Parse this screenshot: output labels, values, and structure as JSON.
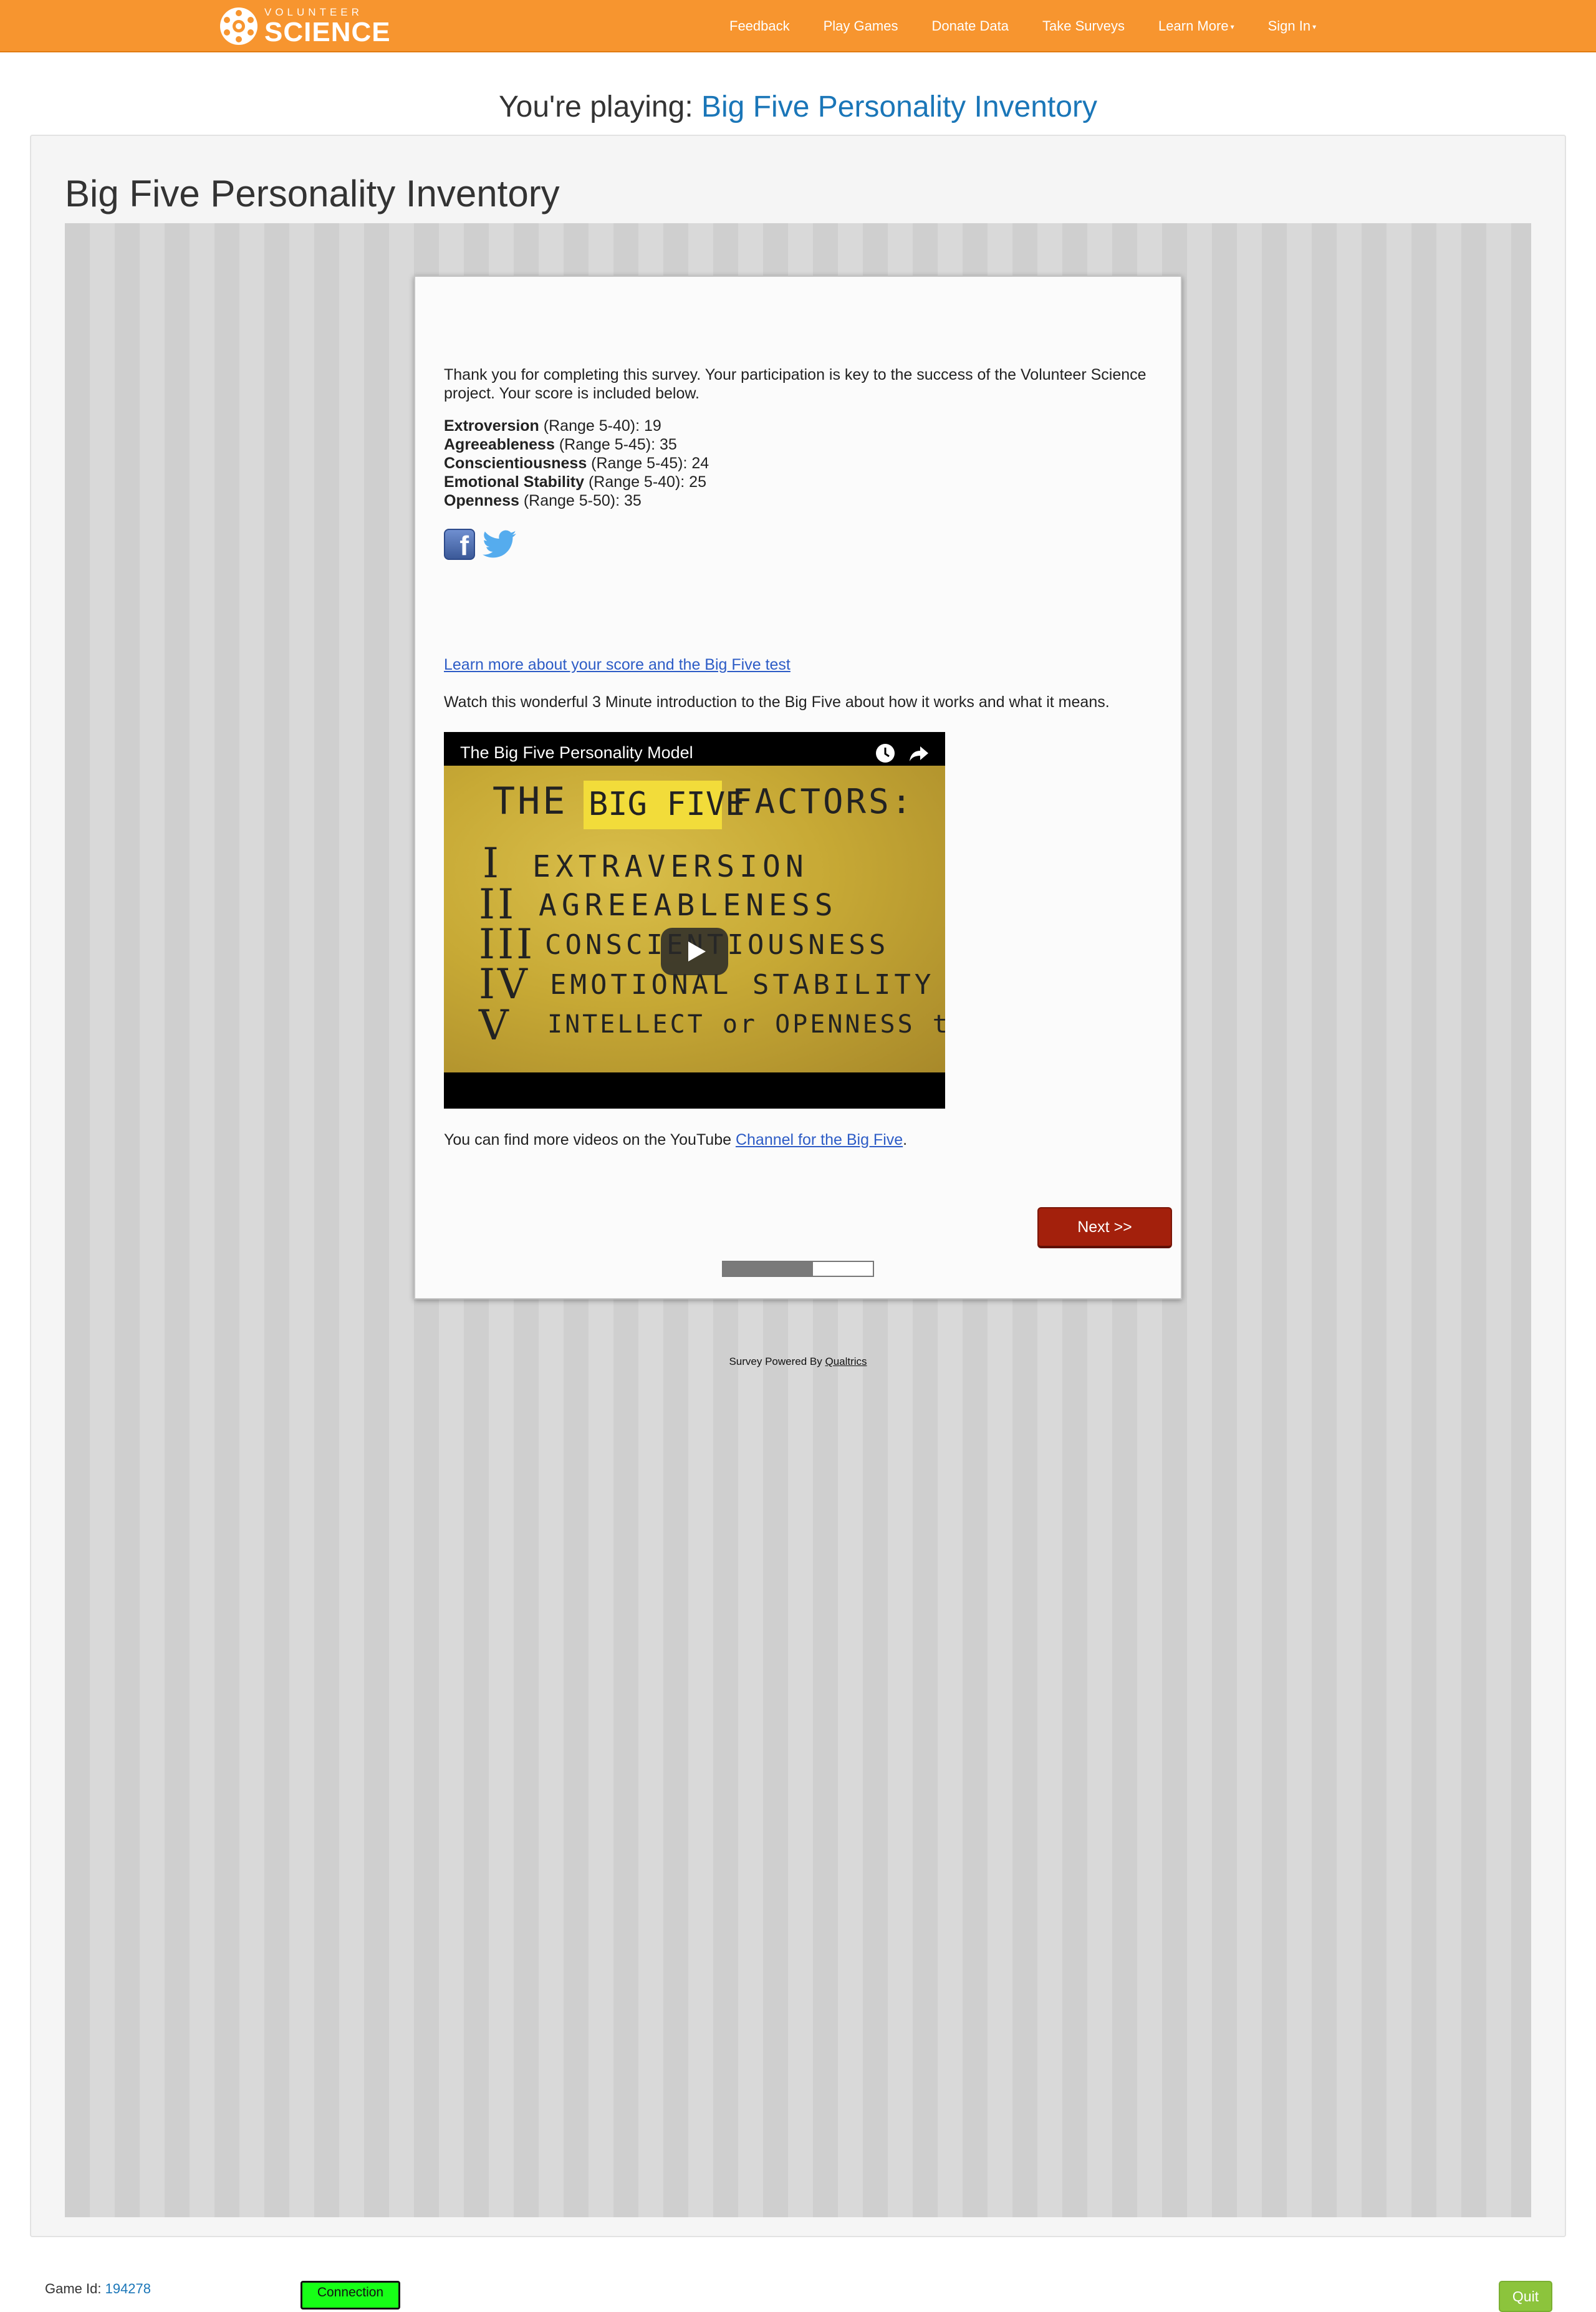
{
  "brand": {
    "top": "VOLUNTEER",
    "main": "SCIENCE"
  },
  "nav": {
    "feedback": "Feedback",
    "play_games": "Play Games",
    "donate_data": "Donate Data",
    "take_surveys": "Take Surveys",
    "learn_more": "Learn More",
    "sign_in": "Sign In"
  },
  "heading": {
    "prefix": "You're playing: ",
    "game_name": "Big Five Personality Inventory"
  },
  "survey": {
    "title": "Big Five Personality Inventory",
    "thanks_text": "Thank you for completing this survey. Your participation is key to the success of the Volunteer Science project.  Your score is included below.",
    "scores": [
      {
        "trait": "Extroversion",
        "detail": " (Range 5-40):  19"
      },
      {
        "trait": "Agreeableness",
        "detail": " (Range 5-45):  35"
      },
      {
        "trait": "Conscientiousness",
        "detail": " (Range 5-45):  24"
      },
      {
        "trait": "Emotional Stability",
        "detail": " (Range 5-40):  25"
      },
      {
        "trait": "Openness",
        "detail": " (Range 5-50): 35"
      }
    ],
    "learn_link": "Learn more about your score and the Big Five test",
    "watch_text": "Watch this wonderful 3 Minute introduction to the Big Five about how it works and what it means.",
    "video": {
      "title": "The Big Five Personality Model",
      "board_heading_1": "THE",
      "board_heading_2": "BIG FIVE",
      "board_heading_3": "FACTORS:",
      "board_lines": [
        {
          "num": "I",
          "text": "EXTRAVERSION"
        },
        {
          "num": "II",
          "text": "AGREEABLENESS"
        },
        {
          "num": "III",
          "text": "CONSCIENTIOUSNESS"
        },
        {
          "num": "IV",
          "text": "EMOTIONAL STABILITY"
        },
        {
          "num": "V",
          "text": "INTELLECT or OPENNESS to EXP"
        }
      ]
    },
    "more_videos_prefix": "You can find more videos on the YouTube ",
    "more_videos_link": "Channel for the Big Five",
    "more_videos_suffix": ".",
    "next_label": "Next >>",
    "progress_fraction": 0.6,
    "powered_prefix": "Survey Powered By ",
    "powered_link": "Qualtrics"
  },
  "footer": {
    "game_id_label": "Game Id: ",
    "game_id": "194278",
    "connection_label": "Connection",
    "quit_label": "Quit"
  },
  "colors": {
    "navbar": "#f7952f",
    "link_blue": "#1a76b8",
    "next_button": "#a3200c",
    "quit_button": "#8cc43c",
    "connection": "#17ff17"
  }
}
